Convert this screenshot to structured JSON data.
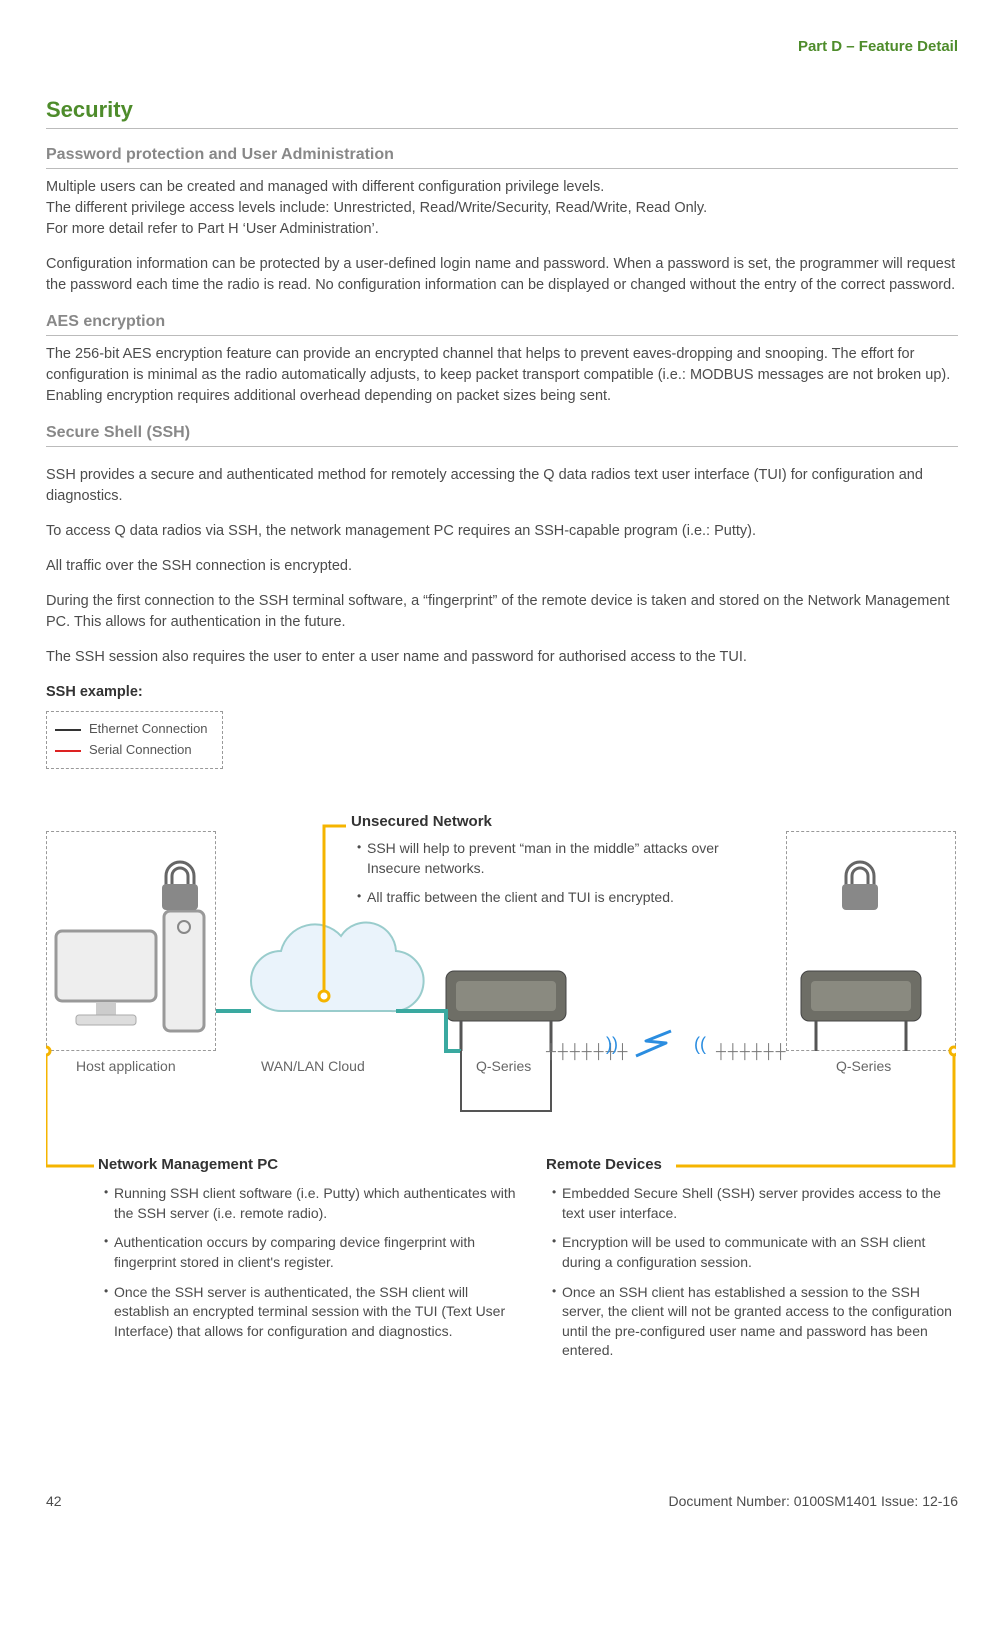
{
  "header": {
    "part": "Part D – Feature Detail"
  },
  "section": {
    "title": "Security",
    "password": {
      "heading": "Password protection and User Administration",
      "p1": "Multiple users can be created and managed with different configuration privilege levels.",
      "p2": "The different privilege access levels include: Unrestricted, Read/Write/Security, Read/Write, Read Only.",
      "p3": "For more detail refer to Part H ‘User Administration’.",
      "p4": "Configuration information can be protected by a user-defined login name and password. When a password is set, the programmer will request the password each time the radio is read. No configuration information can be displayed or changed without the entry of the correct password."
    },
    "aes": {
      "heading": "AES encryption",
      "p1": "The 256-bit AES encryption feature can provide an encrypted channel that helps to prevent eaves-dropping and snooping. The effort for configuration is minimal as the radio automatically adjusts, to keep packet transport compatible (i.e.: MODBUS messages are not broken up). Enabling encryption requires additional overhead depending on packet sizes being sent."
    },
    "ssh": {
      "heading": "Secure Shell (SSH)",
      "p1": "SSH provides a secure and authenticated method for remotely accessing the Q data radios text user interface (TUI) for configuration and diagnostics.",
      "p2": "To access Q data radios via SSH, the network management PC requires an SSH-capable program (i.e.: Putty).",
      "p3": "All traffic over the SSH connection is encrypted.",
      "p4": "During the first connection to the SSH terminal software, a “fingerprint” of the remote device is taken and stored on the Network Management PC. This allows for authentication in the future.",
      "p5": "The SSH session also requires the user to enter a user name and password for authorised access to the TUI.",
      "example_label": "SSH example:"
    }
  },
  "diagram": {
    "legend": {
      "ethernet": "Ethernet Connection",
      "serial": "Serial Connection"
    },
    "labels": {
      "host": "Host application",
      "cloud": "WAN/LAN Cloud",
      "qseries1": "Q-Series",
      "qseries2": "Q-Series"
    },
    "unsecured": {
      "title": "Unsecured Network",
      "b1": "SSH will help to prevent “man in the middle” attacks over Insecure networks.",
      "b2": "All traffic between the client and TUI is encrypted."
    },
    "nmpc": {
      "title": "Network Management PC",
      "b1": "Running SSH client software (i.e. Putty) which authenticates with the SSH server (i.e. remote radio).",
      "b2": "Authentication occurs by comparing device fingerprint with fingerprint stored in client's register.",
      "b3": "Once the SSH server is authenticated, the SSH client will establish an encrypted terminal session with the TUI (Text User Interface) that allows for configuration and diagnostics."
    },
    "remote": {
      "title": "Remote Devices",
      "b1": "Embedded  Secure Shell (SSH) server provides access to the text user interface.",
      "b2": "Encryption will be used to communicate with an SSH client during a configuration session.",
      "b3": "Once an SSH client has established a session to the SSH server, the client will not be granted access to the configuration until the pre-configured user name and password has been entered."
    }
  },
  "footer": {
    "page": "42",
    "doc": "Document Number: 0100SM1401   Issue: 12-16"
  }
}
